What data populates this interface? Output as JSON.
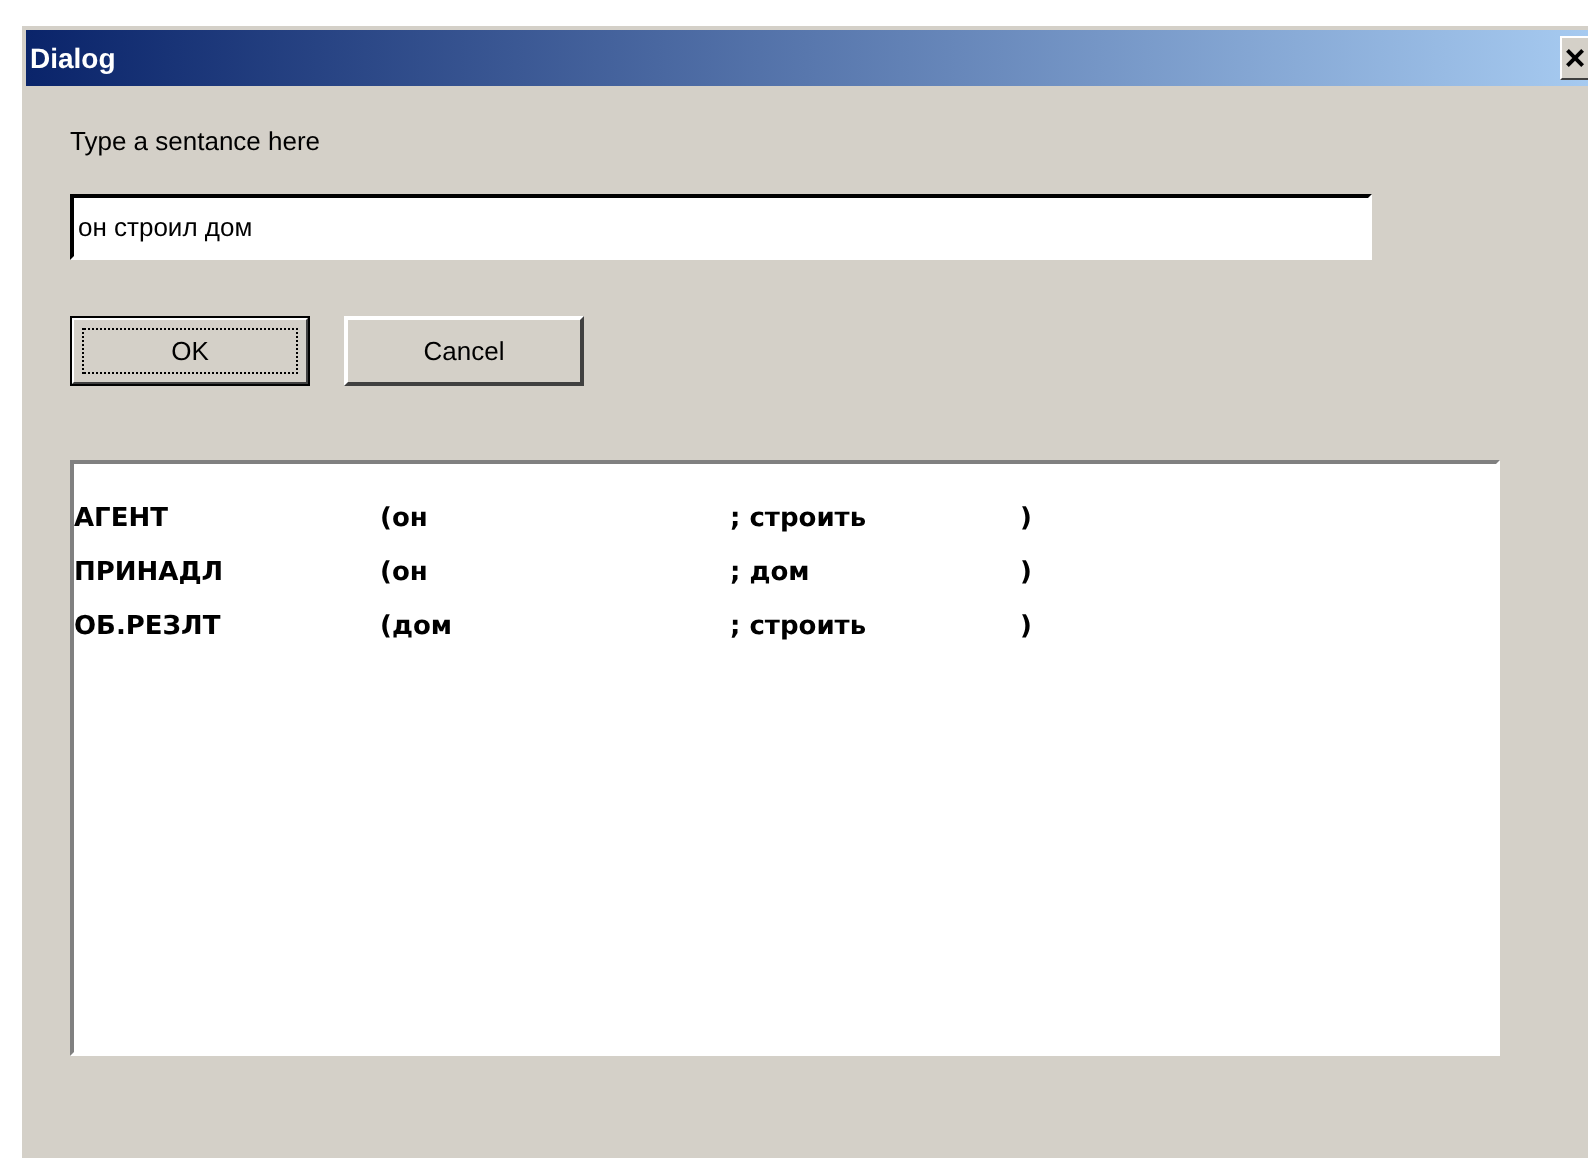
{
  "window": {
    "title": "Dialog",
    "close": "×"
  },
  "prompt": "Type a sentance here",
  "sentence_field": {
    "value": "он строил дом"
  },
  "buttons": [
    {
      "label": "OK",
      "default": true
    },
    {
      "label": "Cancel",
      "default": false
    }
  ],
  "results": [
    {
      "relation": "АГЕНТ",
      "arg1": "(он",
      "arg2": "; строить",
      "end": ")"
    },
    {
      "relation": "ПРИНАДЛ",
      "arg1": "(он",
      "arg2": "; дом",
      "end": ")"
    },
    {
      "relation": "ОБ.РЕЗЛТ",
      "arg1": "(дом",
      "arg2": "; строить",
      "end": ")"
    }
  ]
}
